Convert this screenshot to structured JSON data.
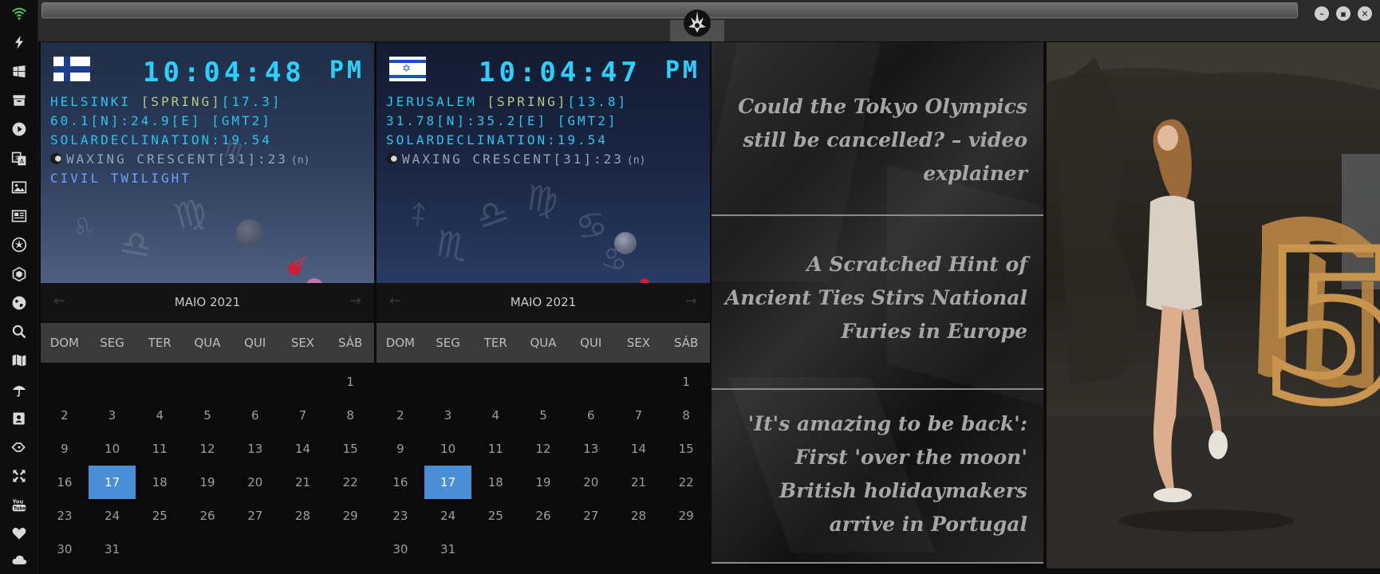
{
  "sidebar": {
    "icons": [
      "wifi-icon",
      "bolt-icon",
      "windows-icon",
      "archive-icon",
      "play-icon",
      "translate-icon",
      "image-icon",
      "newspaper-icon",
      "rebel-alliance-icon",
      "hexagon-icon",
      "globe-icon",
      "search-icon",
      "map-icon",
      "umbrella-icon",
      "contact-icon",
      "tags-icon",
      "expand-icon",
      "youtube-icon",
      "heart-icon",
      "cloud-icon"
    ]
  },
  "window": {
    "controls": [
      "minimize",
      "maximize",
      "close"
    ]
  },
  "clocks": [
    {
      "flag": "finland",
      "time": "10:04:48",
      "ampm": "PM",
      "city_line": {
        "city": "HELSINKI ",
        "season": "[SPRING]",
        "temp": "[17.3]"
      },
      "coords": "60.1[N]:24.9[E] [GMT2]",
      "declination": "SOLARDECLINATION:19.54",
      "moon": "WAXING CRESCENT[31]:23",
      "moon_suffix": "(n)",
      "twilight": "CIVIL TWILIGHT"
    },
    {
      "flag": "israel",
      "time": "10:04:47",
      "ampm": "PM",
      "city_line": {
        "city": "JERUSALEM ",
        "season": "[SPRING]",
        "temp": "[13.8]"
      },
      "coords": "31.78[N]:35.2[E] [GMT2]",
      "declination": "SOLARDECLINATION:19.54",
      "moon": "WAXING CRESCENT[31]:23",
      "moon_suffix": "(n)",
      "twilight": ""
    }
  ],
  "calendars": [
    {
      "month": "MAIO 2021",
      "weekdays": [
        "DOM",
        "SEG",
        "TER",
        "QUA",
        "QUI",
        "SEX",
        "SÁB"
      ],
      "weeks": [
        [
          "",
          "",
          "",
          "",
          "",
          "",
          "1"
        ],
        [
          "2",
          "3",
          "4",
          "5",
          "6",
          "7",
          "8"
        ],
        [
          "9",
          "10",
          "11",
          "12",
          "13",
          "14",
          "15"
        ],
        [
          "16",
          "17",
          "18",
          "19",
          "20",
          "21",
          "22"
        ],
        [
          "23",
          "24",
          "25",
          "26",
          "27",
          "28",
          "29"
        ],
        [
          "30",
          "31",
          "",
          "",
          "",
          "",
          ""
        ]
      ],
      "selected": "17"
    },
    {
      "month": "MAIO 2021",
      "weekdays": [
        "DOM",
        "SEG",
        "TER",
        "QUA",
        "QUI",
        "SEX",
        "SÁB"
      ],
      "weeks": [
        [
          "",
          "",
          "",
          "",
          "",
          "",
          "1"
        ],
        [
          "2",
          "3",
          "4",
          "5",
          "6",
          "7",
          "8"
        ],
        [
          "9",
          "10",
          "11",
          "12",
          "13",
          "14",
          "15"
        ],
        [
          "16",
          "17",
          "18",
          "19",
          "20",
          "21",
          "22"
        ],
        [
          "23",
          "24",
          "25",
          "26",
          "27",
          "28",
          "29"
        ],
        [
          "30",
          "31",
          "",
          "",
          "",
          "",
          ""
        ]
      ],
      "selected": "17"
    }
  ],
  "news": [
    "Could the Tokyo Olympics still be cancelled? – video explainer",
    "A Scratched Hint of Ancient Ties Stirs National Furies in Europe",
    "'It's amazing to be back': First 'over the moon' British holidaymakers arrive in Portugal"
  ],
  "photo": {
    "sign": "5"
  },
  "colors": {
    "lcd": "#26c6f0",
    "season": "#b8c880",
    "twilight": "#6da0ff",
    "selected_day": "#4a8ed6"
  }
}
